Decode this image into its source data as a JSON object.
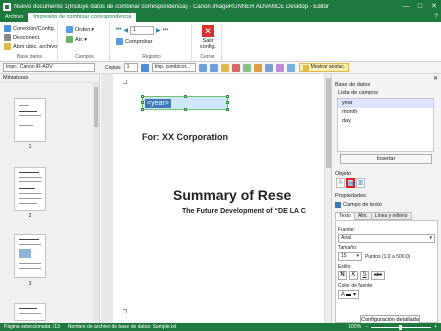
{
  "window": {
    "title": "Nuevo documento 1(Incluye datos de combinar correspondencia) - Canon imageRUNNER ADVANCE Desktop - Editor",
    "minimize": "—",
    "maximize": "□",
    "close": "✕"
  },
  "tabs": [
    {
      "label": "Archivo"
    },
    {
      "label": "Impresión de combinar correspondencia"
    }
  ],
  "ribbon": {
    "base_datos": {
      "label": "Base datos",
      "items": [
        "Conexión/Config.",
        "Desconect.",
        "Abrir ubic. archivo"
      ]
    },
    "campos": {
      "label": "Campos",
      "items": [
        "Orden",
        "Atr."
      ]
    },
    "registro": {
      "label": "Registro",
      "current": "1",
      "items": [
        "Comprobar"
      ]
    },
    "cerrar": {
      "label": "Cerrar",
      "button": "Salir config."
    }
  },
  "toolbar": {
    "printer": "Impr.: Canon iR-ADV",
    "copies_label": "Copias",
    "copies_value": "1",
    "print_combo": "Imp. comb/cor...",
    "show_anot": "Mostrar anotac."
  },
  "thumbnails": {
    "header": "Miniaturas",
    "pages": [
      "1",
      "2",
      "3"
    ]
  },
  "document": {
    "field": "<year>",
    "for_line": "For: XX Corporation",
    "summary": "Summary of Rese",
    "future": "The Future Development of “DE LA C"
  },
  "right_panel": {
    "db_title": "Base de datos",
    "list_title": "Lista de campos",
    "fields": [
      "year",
      "month",
      "day"
    ],
    "selected_field": "year",
    "insert_button": "Insertar",
    "object_title": "Objeto",
    "properties_title": "Propiedades",
    "field_kind": "Campo de texto",
    "subtabs": [
      "Texto",
      "Alin.",
      "Línea y relleno"
    ],
    "font_label": "Fuente:",
    "font_value": "Arial",
    "size_label": "Tamaño:",
    "size_value": "15",
    "size_hint": "Puntos (1.0 a 500.0)",
    "style_label": "Estilo:",
    "styles": [
      "N",
      "K",
      "S",
      "abc"
    ],
    "color_label": "Color de fuente:",
    "detailed_button": "Configuración detallada"
  },
  "statusbar": {
    "selected_page": "Página seleccionada: /13",
    "db_file": "Nombre de archivo de base de datos: Sample.txt",
    "zoom": "100%"
  }
}
